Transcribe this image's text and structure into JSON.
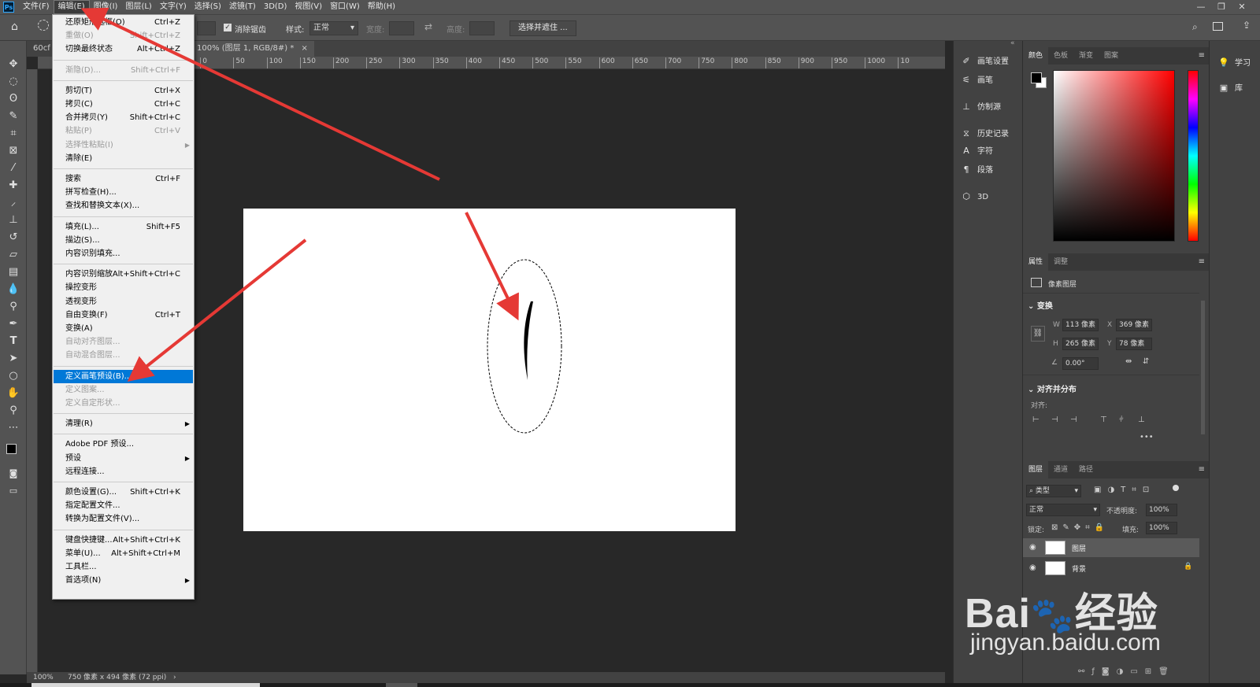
{
  "menubar": {
    "items": [
      "文件(F)",
      "编辑(E)",
      "图像(I)",
      "图层(L)",
      "文字(Y)",
      "选择(S)",
      "滤镜(T)",
      "3D(D)",
      "视图(V)",
      "窗口(W)",
      "帮助(H)"
    ],
    "active_index": 1
  },
  "options_bar": {
    "antialias_label": "消除锯齿",
    "style_label": "样式:",
    "style_value": "正常",
    "width_label": "宽度:",
    "height_label": "高度:",
    "select_mask_label": "选择并遮住 ..."
  },
  "tabs": {
    "tab1": "60cf",
    "tab2": "100% (图层 1, RGB/8#) *"
  },
  "ruler_marks": [
    "50",
    "0",
    "50",
    "100",
    "150",
    "200",
    "250",
    "300",
    "350",
    "400",
    "450",
    "500",
    "550",
    "600",
    "650",
    "700",
    "750",
    "800",
    "850",
    "900",
    "950",
    "1000",
    "10"
  ],
  "status": {
    "zoom": "100%",
    "doc_info": "750 像素 x 494 像素 (72 ppi)"
  },
  "edit_menu": [
    {
      "label": "还原矩形选框(O)",
      "shortcut": "Ctrl+Z",
      "disabled": false
    },
    {
      "label": "重做(O)",
      "shortcut": "Shift+Ctrl+Z",
      "disabled": true
    },
    {
      "label": "切换最终状态",
      "shortcut": "Alt+Ctrl+Z",
      "disabled": false
    },
    {
      "sep": true
    },
    {
      "label": "渐隐(D)...",
      "shortcut": "Shift+Ctrl+F",
      "disabled": true
    },
    {
      "sep": true
    },
    {
      "label": "剪切(T)",
      "shortcut": "Ctrl+X",
      "disabled": false
    },
    {
      "label": "拷贝(C)",
      "shortcut": "Ctrl+C",
      "disabled": false
    },
    {
      "label": "合并拷贝(Y)",
      "shortcut": "Shift+Ctrl+C",
      "disabled": false
    },
    {
      "label": "粘贴(P)",
      "shortcut": "Ctrl+V",
      "disabled": true
    },
    {
      "label": "选择性粘贴(I)",
      "shortcut": "",
      "disabled": true,
      "submenu": true
    },
    {
      "label": "清除(E)",
      "shortcut": "",
      "disabled": false
    },
    {
      "sep": true
    },
    {
      "label": "搜索",
      "shortcut": "Ctrl+F",
      "disabled": false
    },
    {
      "label": "拼写检查(H)...",
      "shortcut": "",
      "disabled": false
    },
    {
      "label": "查找和替换文本(X)...",
      "shortcut": "",
      "disabled": false
    },
    {
      "sep": true
    },
    {
      "label": "填充(L)...",
      "shortcut": "Shift+F5",
      "disabled": false
    },
    {
      "label": "描边(S)...",
      "shortcut": "",
      "disabled": false
    },
    {
      "label": "内容识别填充...",
      "shortcut": "",
      "disabled": false
    },
    {
      "sep": true
    },
    {
      "label": "内容识别缩放",
      "shortcut": "Alt+Shift+Ctrl+C",
      "disabled": false
    },
    {
      "label": "操控变形",
      "shortcut": "",
      "disabled": false
    },
    {
      "label": "透视变形",
      "shortcut": "",
      "disabled": false
    },
    {
      "label": "自由变换(F)",
      "shortcut": "Ctrl+T",
      "disabled": false
    },
    {
      "label": "变换(A)",
      "shortcut": "",
      "disabled": false
    },
    {
      "label": "自动对齐图层...",
      "shortcut": "",
      "disabled": true
    },
    {
      "label": "自动混合图层...",
      "shortcut": "",
      "disabled": true
    },
    {
      "sep": true
    },
    {
      "label": "定义画笔预设(B)...",
      "shortcut": "",
      "disabled": false,
      "highlight": true
    },
    {
      "label": "定义图案...",
      "shortcut": "",
      "disabled": true
    },
    {
      "label": "定义自定形状...",
      "shortcut": "",
      "disabled": true
    },
    {
      "sep": true
    },
    {
      "label": "清理(R)",
      "shortcut": "",
      "disabled": false,
      "submenu": true
    },
    {
      "sep": true
    },
    {
      "label": "Adobe PDF 预设...",
      "shortcut": "",
      "disabled": false
    },
    {
      "label": "预设",
      "shortcut": "",
      "disabled": false,
      "submenu": true
    },
    {
      "label": "远程连接...",
      "shortcut": "",
      "disabled": false
    },
    {
      "sep": true
    },
    {
      "label": "颜色设置(G)...",
      "shortcut": "Shift+Ctrl+K",
      "disabled": false
    },
    {
      "label": "指定配置文件...",
      "shortcut": "",
      "disabled": false
    },
    {
      "label": "转换为配置文件(V)...",
      "shortcut": "",
      "disabled": false
    },
    {
      "sep": true
    },
    {
      "label": "键盘快捷键...",
      "shortcut": "Alt+Shift+Ctrl+K",
      "disabled": false
    },
    {
      "label": "菜单(U)...",
      "shortcut": "Alt+Shift+Ctrl+M",
      "disabled": false
    },
    {
      "label": "工具栏...",
      "shortcut": "",
      "disabled": false
    },
    {
      "label": "首选项(N)",
      "shortcut": "",
      "disabled": false,
      "submenu": true
    }
  ],
  "mid_panel": {
    "brush_settings": "画笔设置",
    "brush": "画笔",
    "clone_source": "仿制源",
    "history": "历史记录",
    "character": "字符",
    "paragraph": "段落",
    "three_d": "3D"
  },
  "color_panel": {
    "tabs": [
      "颜色",
      "色板",
      "渐变",
      "图案"
    ]
  },
  "properties_panel": {
    "tabs": [
      "属性",
      "调整"
    ],
    "pixel_layer": "像素图层",
    "transform_title": "变换",
    "w_label": "W",
    "w_value": "113 像素",
    "h_label": "H",
    "h_value": "265 像素",
    "x_label": "X",
    "x_value": "369 像素",
    "y_label": "Y",
    "y_value": "78 像素",
    "angle_value": "0.00°",
    "align_title": "对齐并分布",
    "align_label": "对齐:"
  },
  "layers_panel": {
    "tabs": [
      "图层",
      "通道",
      "路径"
    ],
    "filter_label": "类型",
    "blend_mode": "正常",
    "opacity_label": "不透明度:",
    "opacity_value": "100%",
    "lock_label": "锁定:",
    "fill_label": "填充:",
    "fill_value": "100%",
    "layer1_name": "图层",
    "background_name": "背景"
  },
  "far_right": {
    "learn": "学习",
    "libraries": "库"
  },
  "watermark": {
    "brand": "Bai",
    "brand2": "经验",
    "url": "jingyan.baidu.com"
  },
  "colors": {
    "accent": "#0078d7",
    "annotation_arrow": "#e53935"
  }
}
